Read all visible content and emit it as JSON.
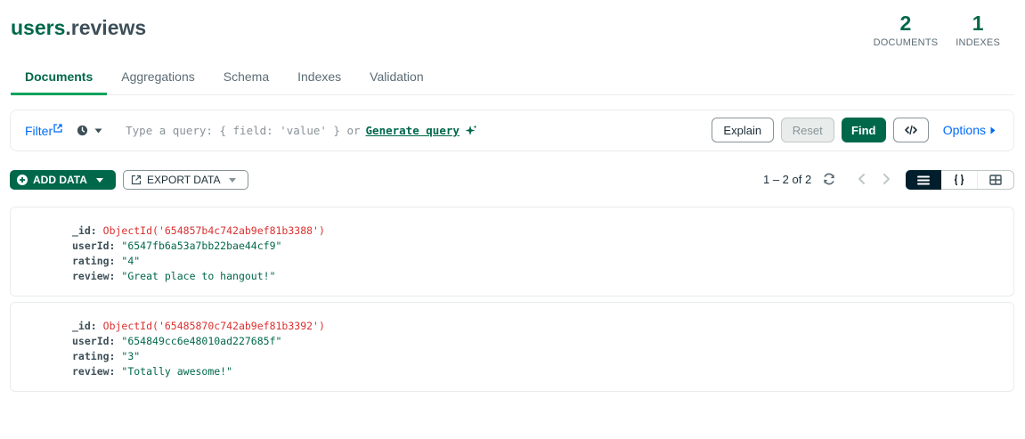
{
  "header": {
    "db": "users",
    "sep": ".",
    "collection": "reviews"
  },
  "stats": [
    {
      "count": "2",
      "label": "DOCUMENTS"
    },
    {
      "count": "1",
      "label": "INDEXES"
    }
  ],
  "tabs": [
    {
      "label": "Documents"
    },
    {
      "label": "Aggregations"
    },
    {
      "label": "Schema"
    },
    {
      "label": "Indexes"
    },
    {
      "label": "Validation"
    }
  ],
  "querybar": {
    "filter_label": "Filter",
    "placeholder_prefix": "Type a query: { field: 'value' } or",
    "generate_query": "Generate query",
    "explain": "Explain",
    "reset": "Reset",
    "find": "Find",
    "options": "Options"
  },
  "toolbar": {
    "add_data": "ADD DATA",
    "export_data": "EXPORT DATA",
    "pagination": "1 – 2 of 2"
  },
  "documents": [
    {
      "id_key": "_id",
      "id_value": "ObjectId('654857b4c742ab9ef81b3388')",
      "userId_key": "userId",
      "userId_value": "\"6547fb6a53a7bb22bae44cf9\"",
      "rating_key": "rating",
      "rating_value": "\"4\"",
      "review_key": "review",
      "review_value": "\"Great place to hangout!\""
    },
    {
      "id_key": "_id",
      "id_value": "ObjectId('65485870c742ab9ef81b3392')",
      "userId_key": "userId",
      "userId_value": "\"654849cc6e48010ad227685f\"",
      "rating_key": "rating",
      "rating_value": "\"3\"",
      "review_key": "review",
      "review_value": "\"Totally awesome!\""
    }
  ],
  "colors": {
    "brand": "#00684a",
    "accent": "#00a35c",
    "link": "#016bf8",
    "objectid": "#db3030",
    "toggle_active": "#001e2b"
  }
}
